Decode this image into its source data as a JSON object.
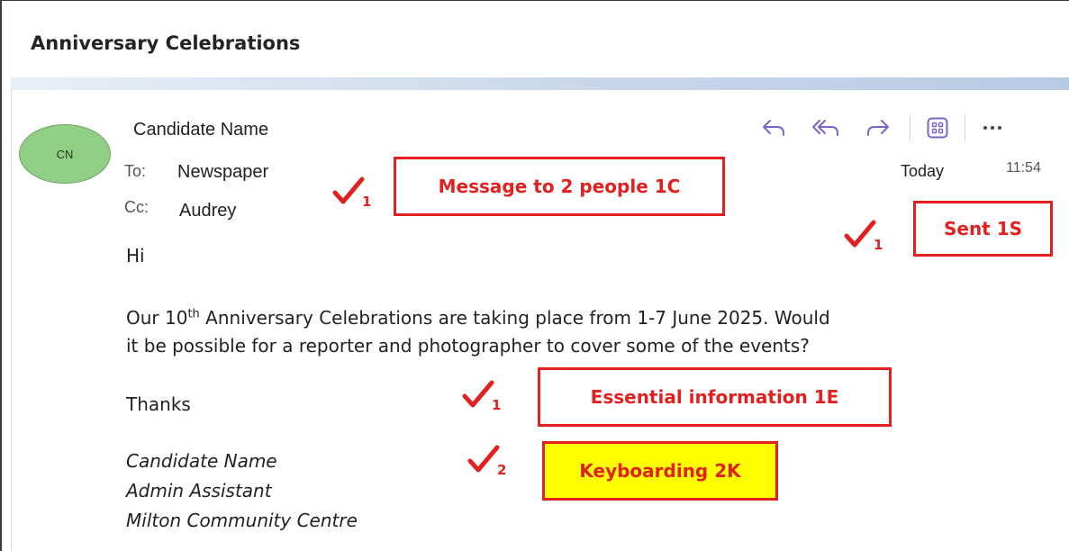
{
  "email": {
    "subject": "Anniversary Celebrations",
    "avatar_initials": "CN",
    "sender": "Candidate Name",
    "to_label": "To:",
    "to_value": "Newspaper",
    "cc_label": "Cc:",
    "cc_value": "Audrey",
    "date": "Today",
    "time": "11:54",
    "toolbar": [
      "reply-icon",
      "reply-all-icon",
      "forward-icon",
      "apps-icon",
      "more-icon"
    ],
    "greeting": "Hi",
    "para_line1_pre": "Our 10",
    "para_line1_sup": "th",
    "para_line1_post": " Anniversary Celebrations are taking place from 1-7 June 2025.  Would",
    "para_line2": "it be possible for a reporter and photographer to cover some of the events?",
    "closing": "Thanks",
    "signature": [
      "Candidate Name",
      "Admin Assistant",
      "Milton Community Centre"
    ]
  },
  "annotations": {
    "message": "Message to 2 people 1C",
    "sent": "Sent 1S",
    "essential": "Essential information 1E",
    "keyboarding": "Keyboarding 2K",
    "tick_colors": "#e2201f",
    "tick_numbers": [
      "1",
      "1",
      "1",
      "2"
    ]
  }
}
